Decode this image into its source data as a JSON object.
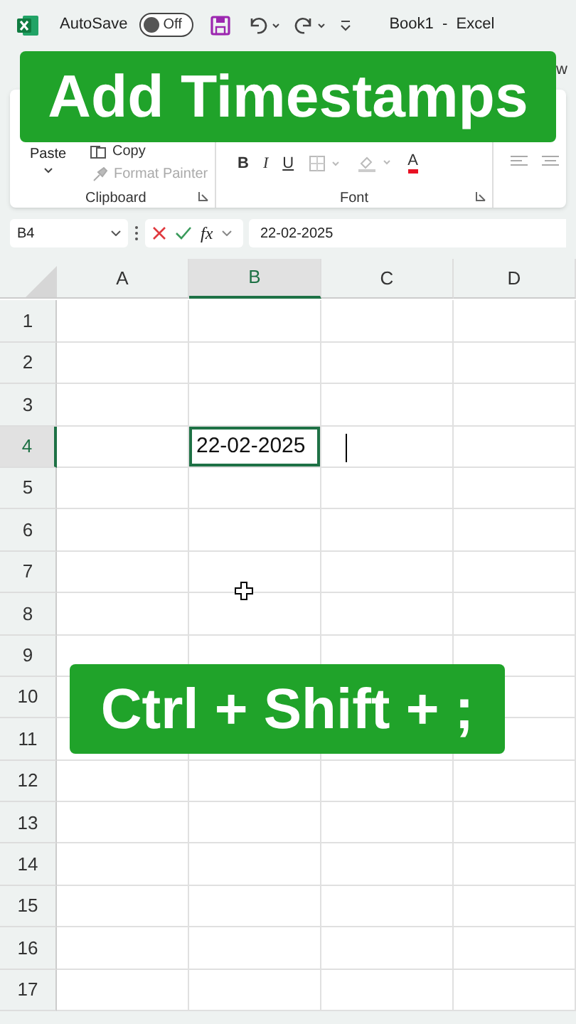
{
  "window": {
    "title": "Book1  -  Excel",
    "autosave": {
      "label": "AutoSave",
      "on": false,
      "state_text": "Off"
    }
  },
  "ribbon": {
    "tab_fragment": "w",
    "clipboard": {
      "paste": "Paste",
      "copy": "Copy",
      "format_painter": "Format Painter",
      "group_label": "Clipboard"
    },
    "font": {
      "bold": "B",
      "italic": "I",
      "underline": "U",
      "font_letter": "A",
      "group_label": "Font"
    }
  },
  "formula_bar": {
    "name_box": "B4",
    "fx": "fx",
    "value": "22-02-2025"
  },
  "sheet": {
    "columns": [
      {
        "label": "A",
        "selected": false
      },
      {
        "label": "B",
        "selected": true
      },
      {
        "label": "C",
        "selected": false
      },
      {
        "label": "D",
        "selected": false
      }
    ],
    "rows": [
      {
        "label": "1",
        "selected": false
      },
      {
        "label": "2",
        "selected": false
      },
      {
        "label": "3",
        "selected": false
      },
      {
        "label": "4",
        "selected": true
      },
      {
        "label": "5",
        "selected": false
      },
      {
        "label": "6",
        "selected": false
      },
      {
        "label": "7",
        "selected": false
      },
      {
        "label": "8",
        "selected": false
      },
      {
        "label": "9",
        "selected": false
      },
      {
        "label": "10",
        "selected": false
      },
      {
        "label": "11",
        "selected": false
      },
      {
        "label": "12",
        "selected": false
      },
      {
        "label": "13",
        "selected": false
      },
      {
        "label": "14",
        "selected": false
      },
      {
        "label": "15",
        "selected": false
      },
      {
        "label": "16",
        "selected": false
      },
      {
        "label": "17",
        "selected": false
      }
    ],
    "active_cell": {
      "value": "22-02-2025",
      "editing": true
    }
  },
  "overlays": {
    "title_banner": "Add Timestamps",
    "shortcut_banner": "Ctrl + Shift + ;"
  }
}
